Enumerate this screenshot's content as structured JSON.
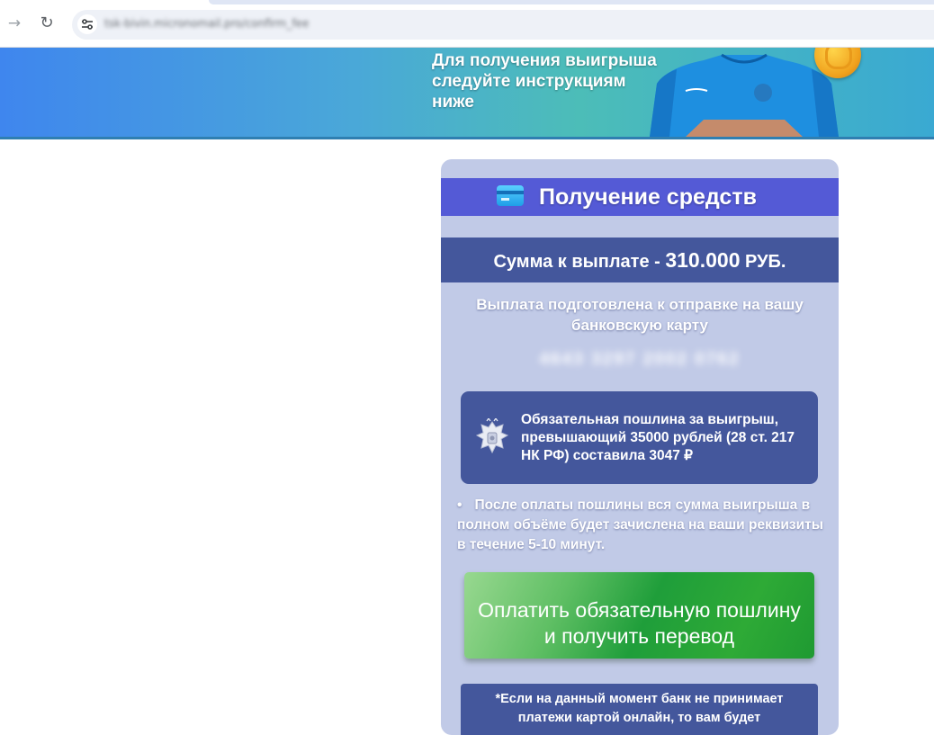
{
  "browser": {
    "url": "tsk-bivin.micronomail.pro/confirm_fee"
  },
  "banner": {
    "text": "Для получения выигрыша следуйте инструкциям ниже"
  },
  "card": {
    "title": "Получение средств",
    "amount_prefix": "Сумма к выплате - ",
    "amount_value": "310.000",
    "amount_suffix": " РУБ.",
    "prepared_text": "Выплата подготовлена к отправке на вашу банковскую карту",
    "card_number": "4643 3297 2002 0762",
    "duty_text": "Обязательная пошлина за выигрыш, превышающий 35000 рублей (28 ст. 217 НК РФ) составила 3047 ₽",
    "bullet_symbol": "•",
    "bullet_text": "После оплаты пошлины вся сумма выигрыша в полном объёме будет зачислена на ваши реквизиты в течение 5-10 минут.",
    "pay_button_label": "Оплатить обязательную пошлину и получить перевод",
    "note_text": "*Если на данный момент банк не принимает платежи картой онлайн, то вам будет"
  },
  "colors": {
    "card_bg": "#c1cae7",
    "header_bg": "#545ad6",
    "dark_block": "#44579c",
    "button_green": "#1f9e3a"
  },
  "icons": {
    "forward": "arrow-right-icon",
    "reload": "reload-icon",
    "site_info": "tune-icon",
    "card": "credit-card-icon",
    "emblem": "coat-of-arms-icon"
  }
}
